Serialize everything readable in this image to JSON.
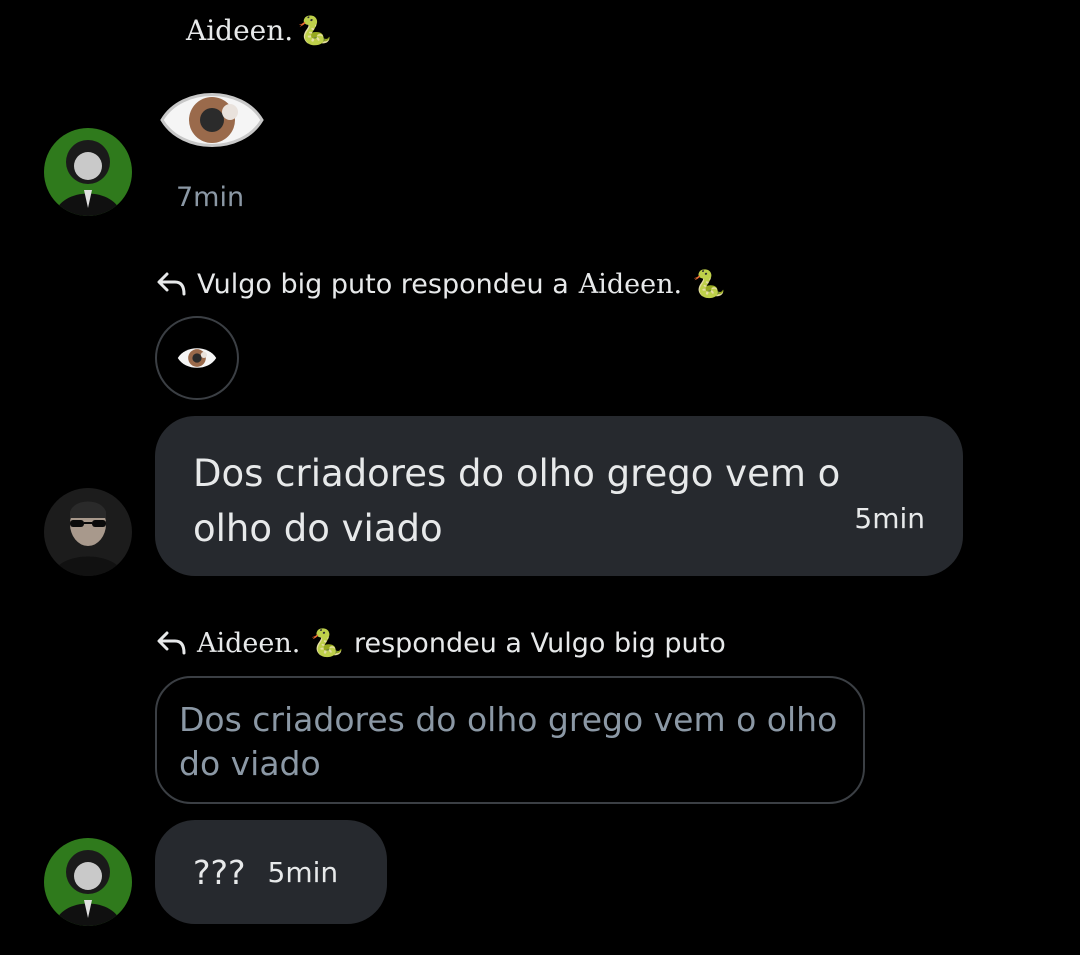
{
  "message1": {
    "sender": "Aideen.",
    "sender_emoji": "🐍",
    "timestamp": "7min"
  },
  "reply1": {
    "header_prefix": "Vulgo big puto respondeu a",
    "header_target": "Aideen.",
    "header_emoji": "🐍",
    "text_line1": "Dos criadores do olho grego vem o",
    "text_line2": "olho do viado",
    "timestamp": "5min"
  },
  "reply2": {
    "header_name": "Aideen.",
    "header_emoji": "🐍",
    "header_suffix": "respondeu a Vulgo big puto",
    "quoted_text": "Dos criadores do olho grego vem o olho do viado",
    "text": "???",
    "timestamp": "5min"
  },
  "colors": {
    "background": "#000000",
    "bubble": "#26292e",
    "muted_text": "#8b98a5",
    "border": "#3b3f44"
  }
}
